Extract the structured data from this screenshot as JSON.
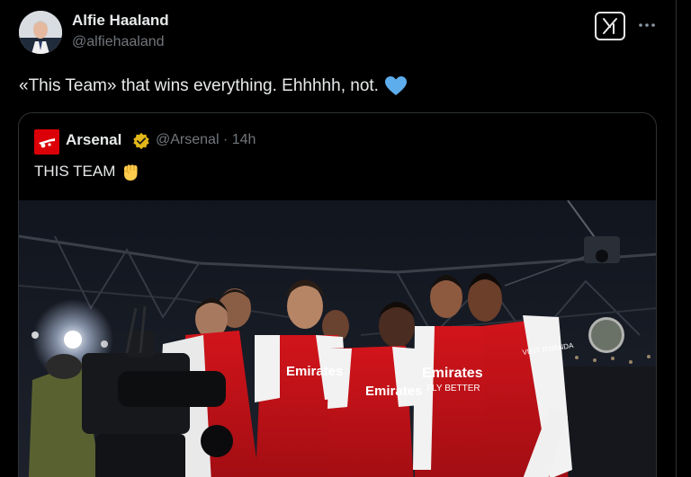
{
  "tweet": {
    "author_name": "Alfie Haaland",
    "author_handle": "@alfiehaaland",
    "text": "«This Team» that wins everything. Ehhhhh, not.",
    "emoji_icon": "blue-heart-icon",
    "menu_icon": "more-dots-icon",
    "grok_icon": "grok-icon"
  },
  "quote": {
    "author_name": "Arsenal",
    "author_handle": "@Arsenal",
    "separator": "·",
    "time": "14h",
    "text": "THIS TEAM",
    "emoji_icon": "raised-fist-icon",
    "verified_icon": "gold-verified-badge-icon",
    "shirt_sponsor": "Emirates",
    "shirt_sponsor_line2": "FLY BETTER",
    "shirt_sleeve": "VISIT RWANDA"
  },
  "colors": {
    "background": "#000000",
    "text_primary": "#e7e9ea",
    "text_secondary": "#71767b",
    "border": "#2f3336",
    "arsenal_red": "#db0007",
    "verified_gold": "#e2b719",
    "heart_blue": "#5dadec"
  }
}
